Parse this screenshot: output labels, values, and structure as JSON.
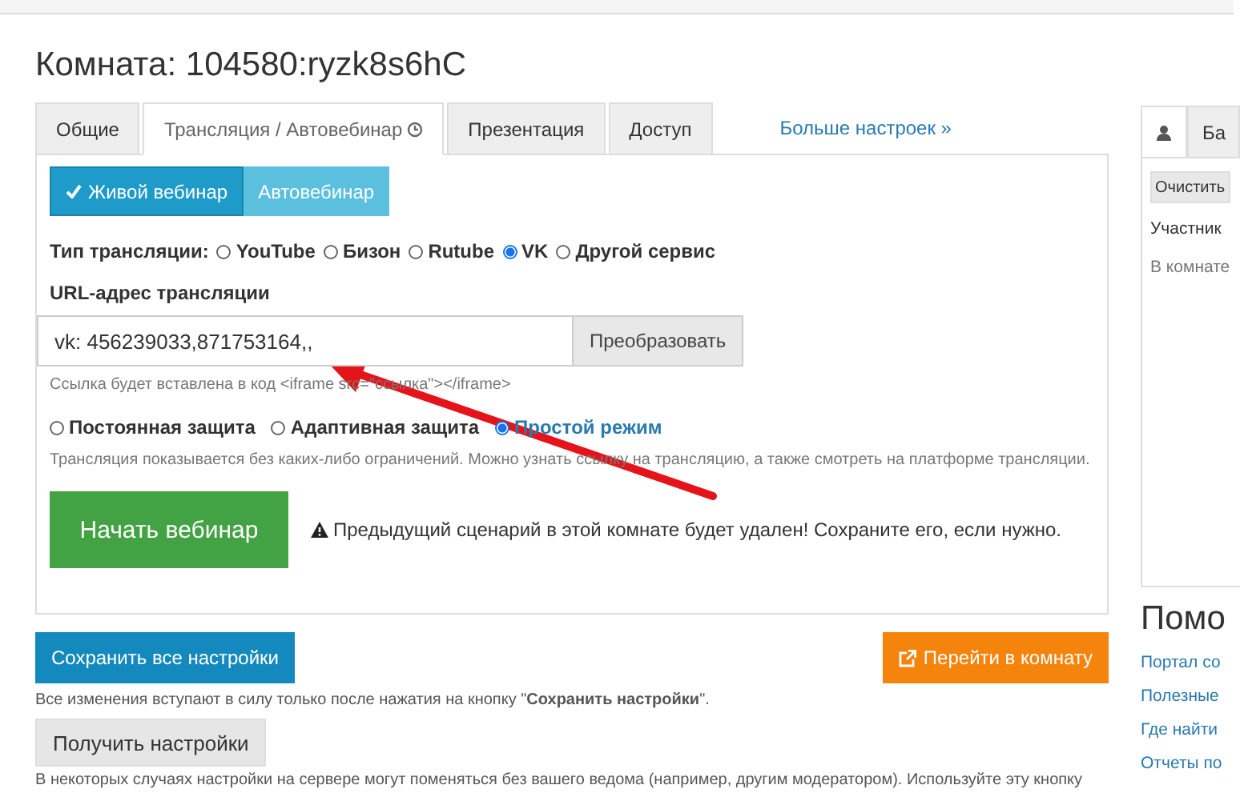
{
  "title": "Комната: 104580:ryzk8s6hC",
  "tabs": [
    {
      "label": "Общие",
      "selected": false
    },
    {
      "label": "Трансляция / Автовебинар",
      "selected": true
    },
    {
      "label": "Презентация",
      "selected": false
    },
    {
      "label": "Доступ",
      "selected": false
    }
  ],
  "more_settings_link": "Больше настроек »",
  "mode_toggle": [
    {
      "label": "Живой вебинар",
      "selected": true
    },
    {
      "label": "Автовебинар",
      "selected": false
    }
  ],
  "stream_type": {
    "label": "Тип трансляции:",
    "options": [
      {
        "label": "YouTube",
        "selected": false
      },
      {
        "label": "Бизон",
        "selected": false
      },
      {
        "label": "Rutube",
        "selected": false
      },
      {
        "label": "VK",
        "selected": true
      },
      {
        "label": "Другой сервис",
        "selected": false
      }
    ]
  },
  "url": {
    "label": "URL-адрес трансляции",
    "value": "vk: 456239033,871753164,,",
    "convert_button": "Преобразовать",
    "hint": "Ссылка будет вставлена в код <iframe src=\"ссылка\"></iframe>"
  },
  "protection": {
    "options": [
      {
        "label": "Постоянная защита",
        "selected": false
      },
      {
        "label": "Адаптивная защита",
        "selected": false
      },
      {
        "label": "Простой режим",
        "selected": true
      }
    ],
    "description": "Трансляция показывается без каких-либо ограничений. Можно узнать ссылку на трансляцию, а также смотреть на платформе трансляции."
  },
  "start_button": "Начать вебинар",
  "warning": "Предыдущий сценарий в этой комнате будет удален! Сохраните его, если нужно.",
  "save_button": "Сохранить все настройки",
  "open_room_button": "Перейти в комнату",
  "save_note": "Все изменения вступают в силу только после нажатия на кнопку \"**Сохранить настройки**\".",
  "get_settings_button": "Получить настройки",
  "get_settings_note": "В некоторых случаях настройки на сервере могут поменяться без вашего ведома (например, другим модератором). Используйте эту кнопку",
  "sidebar": {
    "tabs": [
      {
        "kind": "icon",
        "selected": true
      },
      {
        "kind": "text",
        "label": "Ба",
        "selected": false
      }
    ],
    "clear_button": "Очистить",
    "participants_heading": "Участник",
    "participants_empty": "В комнате"
  },
  "help": {
    "title": "Помо",
    "links": [
      "Портал со",
      "Полезные",
      "Где найти",
      "Отчеты по"
    ]
  }
}
